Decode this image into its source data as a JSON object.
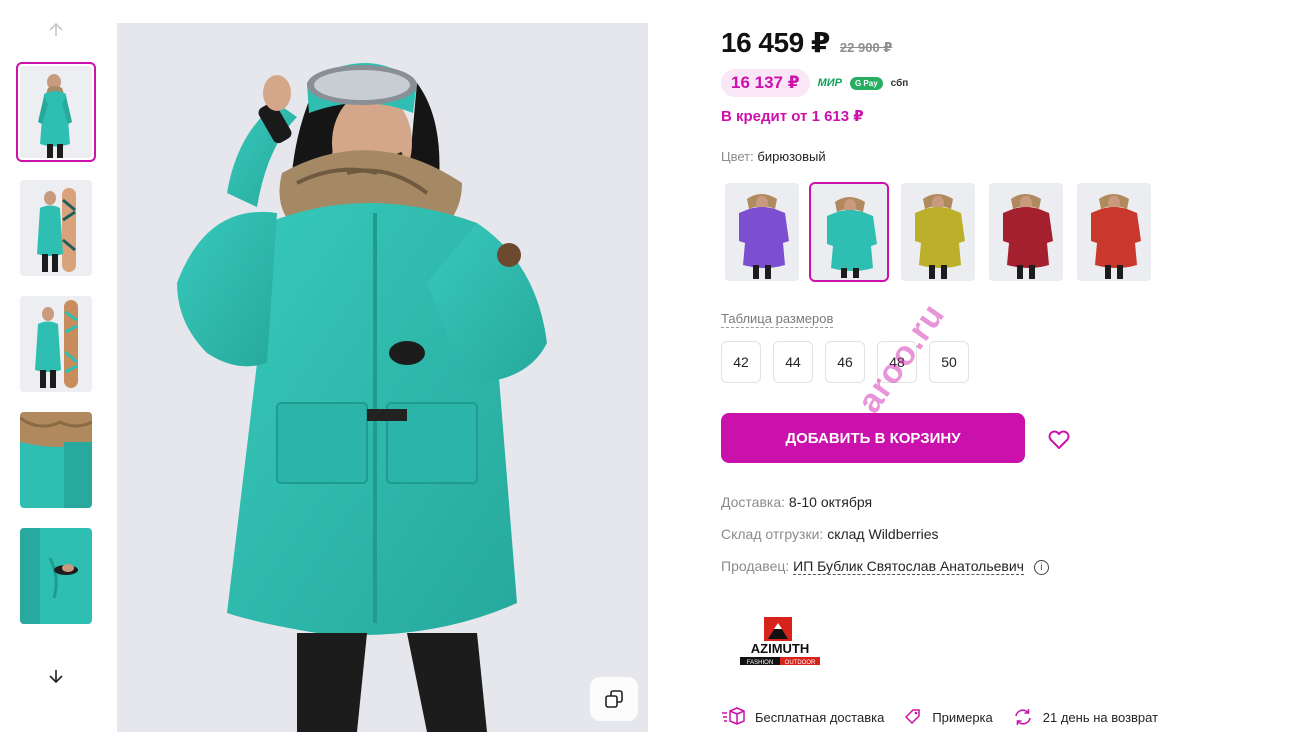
{
  "gallery": {
    "thumbnails": [
      {
        "alt": "teal parka front"
      },
      {
        "alt": "teal parka with snowboard"
      },
      {
        "alt": "teal parka with snowboard 2"
      },
      {
        "alt": "fur hood detail"
      },
      {
        "alt": "pocket detail"
      }
    ],
    "selected_index": 0
  },
  "price": {
    "current": "16 459 ₽",
    "old": "22 900 ₽",
    "wallet_price": "16 137 ₽",
    "payment_methods": [
      "МИР",
      "G Pay",
      "сбп"
    ],
    "credit": "В кредит от 1 613 ₽"
  },
  "color": {
    "label": "Цвет:",
    "value": "бирюзовый",
    "swatches": [
      {
        "name": "purple",
        "coat": "#7d4fd0"
      },
      {
        "name": "turquoise",
        "coat": "#2fbfb2"
      },
      {
        "name": "mustard",
        "coat": "#bcb02a"
      },
      {
        "name": "burgundy",
        "coat": "#a5202e"
      },
      {
        "name": "red",
        "coat": "#c8382c"
      }
    ],
    "selected_index": 1
  },
  "sizes": {
    "table_link": "Таблица размеров",
    "options": [
      "42",
      "44",
      "46",
      "48",
      "50"
    ]
  },
  "actions": {
    "add_to_cart": "ДОБАВИТЬ В КОРЗИНУ"
  },
  "watermark": "aroo.ru",
  "info": {
    "delivery_label": "Доставка:",
    "delivery_value": "8-10 октября",
    "warehouse_label": "Склад отгрузки:",
    "warehouse_value": "склад Wildberries",
    "seller_label": "Продавец:",
    "seller_value": "ИП Бублик Святослав Анатольевич",
    "info_icon": "i"
  },
  "brand": {
    "name": "AZIMUTH",
    "sub_left": "FASHION",
    "sub_right": "OUTDOOR"
  },
  "features": [
    {
      "label": "Бесплатная доставка",
      "icon": "box-icon"
    },
    {
      "label": "Примерка",
      "icon": "tag-icon"
    },
    {
      "label": "21 день на возврат",
      "icon": "refresh-icon"
    }
  ],
  "colors": {
    "accent": "#cb11ab",
    "teal": "#2fbfb2"
  }
}
